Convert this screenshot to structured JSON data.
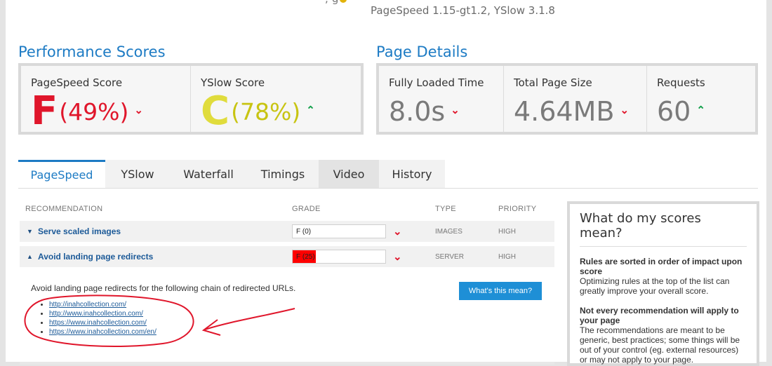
{
  "header": {
    "cut_text": "; g",
    "versions": "PageSpeed 1.15-gt1.2, YSlow 3.1.8"
  },
  "performance": {
    "title": "Performance Scores",
    "pagespeed": {
      "label": "PageSpeed Score",
      "grade": "F",
      "percent": "(49%)",
      "trend": "down",
      "color": "#e0162b"
    },
    "yslow": {
      "label": "YSlow Score",
      "grade": "C",
      "percent": "(78%)",
      "trend": "up",
      "color": "#c8c412"
    }
  },
  "details": {
    "title": "Page Details",
    "load_time": {
      "label": "Fully Loaded Time",
      "value": "8.0s",
      "trend": "down"
    },
    "page_size": {
      "label": "Total Page Size",
      "value": "4.64MB",
      "trend": "down"
    },
    "requests": {
      "label": "Requests",
      "value": "60",
      "trend": "up"
    }
  },
  "tabs": [
    {
      "label": "PageSpeed"
    },
    {
      "label": "YSlow"
    },
    {
      "label": "Waterfall"
    },
    {
      "label": "Timings"
    },
    {
      "label": "Video"
    },
    {
      "label": "History"
    }
  ],
  "table": {
    "headers": {
      "recommendation": "RECOMMENDATION",
      "grade": "GRADE",
      "type": "TYPE",
      "priority": "PRIORITY"
    },
    "rows": [
      {
        "name": "Serve scaled images",
        "grade": "F (0)",
        "grade_fraction": 0,
        "type": "IMAGES",
        "priority": "HIGH",
        "expanded": false
      },
      {
        "name": "Avoid landing page redirects",
        "grade": "F (25)",
        "grade_fraction": 0.25,
        "type": "SERVER",
        "priority": "HIGH",
        "expanded": true
      }
    ]
  },
  "detail": {
    "text": "Avoid landing page redirects for the following chain of redirected URLs.",
    "button": "What's this mean?",
    "urls": [
      "http://inahcollection.com/",
      "http://www.inahcollection.com/",
      "https://www.inahcollection.com/",
      "https://www.inahcollection.com/en/"
    ]
  },
  "sidebar": {
    "title": "What do my scores mean?",
    "h1": "Rules are sorted in order of impact upon score",
    "p1": "Optimizing rules at the top of the list can greatly improve your overall score.",
    "h2": "Not every recommendation will apply to your page",
    "p2": "The recommendations are meant to be generic, best practices; some things will be out of your control (eg. external resources) or may not apply to your page."
  },
  "icons": {
    "trend_down": "chevron-down-icon",
    "trend_up": "chevron-up-icon",
    "row_collapsed": "triangle-down-icon",
    "row_expanded": "triangle-up-icon"
  },
  "colors": {
    "accent": "#1d7bc4",
    "bad": "#e0162b",
    "good": "#12a04a",
    "annotation": "#e0162b"
  }
}
